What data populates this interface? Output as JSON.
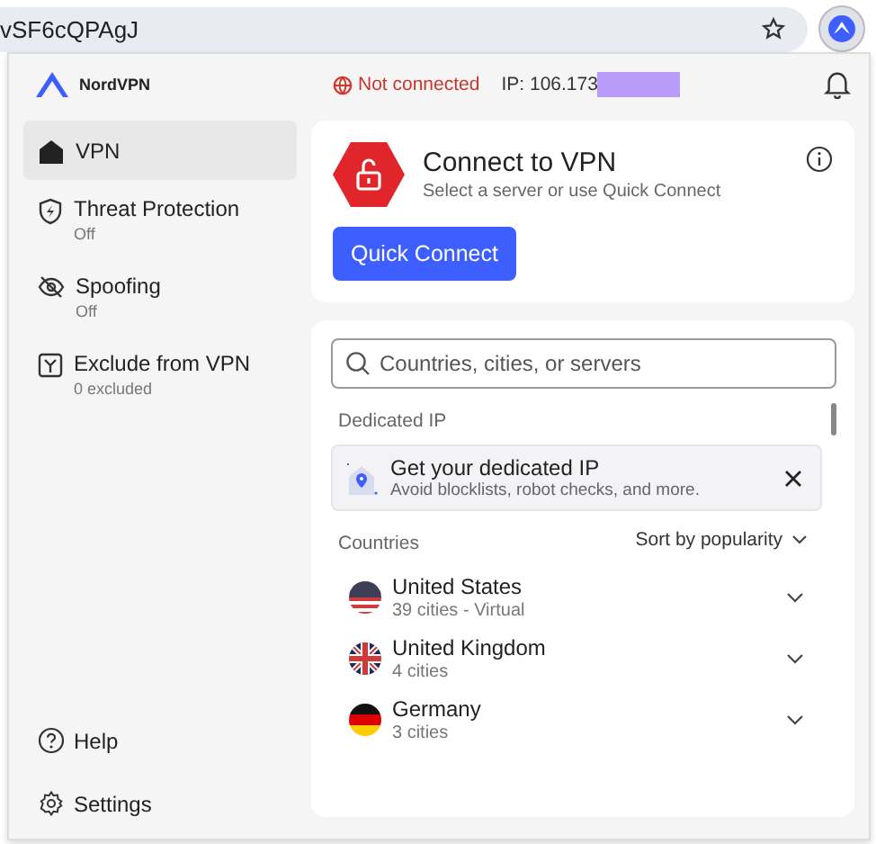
{
  "browser": {
    "url": "vSF6cQPAgJ"
  },
  "header": {
    "brand": "NordVPN",
    "status": "Not connected",
    "ip": "IP: 106.173"
  },
  "sidebar": {
    "items": [
      {
        "kind": "vpn",
        "label": "VPN",
        "selected": true
      },
      {
        "kind": "threat",
        "label": "Threat Protection",
        "sub": "Off",
        "selected": false
      },
      {
        "kind": "spoofing",
        "label": "Spoofing",
        "sub": "Off",
        "selected": false
      },
      {
        "kind": "exclude",
        "label": "Exclude from VPN",
        "sub": "0 excluded",
        "selected": false
      }
    ],
    "bottom": [
      {
        "kind": "help",
        "label": "Help"
      },
      {
        "kind": "settings",
        "label": "Settings"
      }
    ]
  },
  "connect": {
    "title": "Connect to VPN",
    "subtitle": "Select a server or use Quick Connect",
    "button": "Quick Connect"
  },
  "search": {
    "placeholder": "Countries, cities, or servers"
  },
  "dedicated": {
    "heading": "Dedicated IP",
    "title": "Get your dedicated IP",
    "text": "Avoid blocklists, robot checks, and more."
  },
  "countries": {
    "heading": "Countries",
    "sort": "Sort by popularity",
    "items": [
      {
        "kind": "us",
        "name": "United States",
        "sub": "39 cities - Virtual"
      },
      {
        "kind": "uk",
        "name": "United Kingdom",
        "sub": "4 cities"
      },
      {
        "kind": "de",
        "name": "Germany",
        "sub": "3 cities"
      }
    ]
  }
}
